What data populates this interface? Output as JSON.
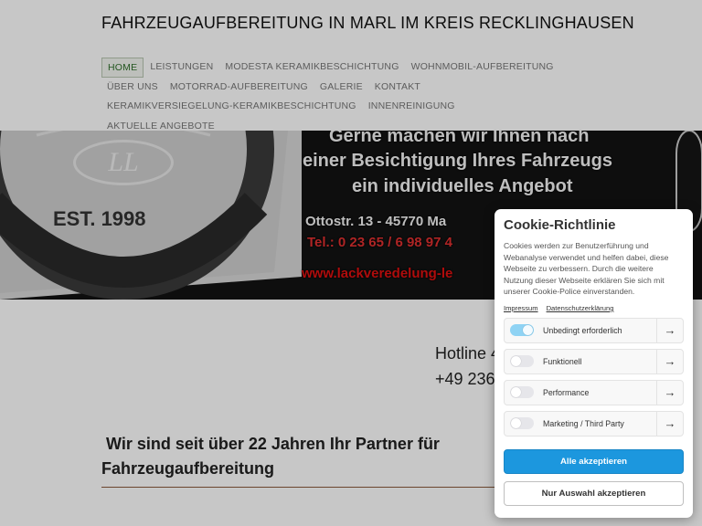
{
  "site": {
    "title": "FAHRZEUGAUFBEREITUNG IN MARL IM KREIS RECKLINGHAUSEN",
    "nav": [
      "HOME",
      "LEISTUNGEN",
      "MODESTA KERAMIKBESCHICHTUNG",
      "WOHNMOBIL-AUFBEREITUNG",
      "ÜBER UNS",
      "MOTORRAD-AUFBEREITUNG",
      "GALERIE",
      "KONTAKT",
      "KERAMIKVERSIEGELUNG-KERAMIKBESCHICHTUNG",
      "INNENREINIGUNG",
      "AKTUELLE ANGEBOTE"
    ],
    "active_nav": "HOME"
  },
  "banner": {
    "line1": "Gerne machen wir Ihnen nach",
    "line2": "einer Besichtigung Ihres Fahrzeugs",
    "line3": "ein individuelles Angebot",
    "address": "Ottostr. 13  - 45770 Ma",
    "phone": "Tel.: 0 23 65 / 6 98 97 4",
    "url": "www.lackveredelung-le",
    "est": "EST. 1998",
    "logo_ring_text": "CAR-DETAILING",
    "logo_monogram": "LL"
  },
  "content": {
    "hotline": "Hotline 4",
    "phone": "+49 236",
    "headline_line1": " Wir sind seit über 22 Jahren Ihr Partner für",
    "headline_line2": "Fahrzeugaufbereitung"
  },
  "cookie": {
    "title": "Cookie-Richtlinie",
    "text": "Cookies werden zur Benutzerführung und Webanalyse verwendet und helfen dabei, diese Webseite zu verbessern. Durch die weitere Nutzung dieser Webseite erklären Sie sich mit unserer Cookie-Police einverstanden.",
    "link_impressum": "Impressum",
    "link_privacy": "Datenschutzerklärung",
    "categories": [
      {
        "label": "Unbedingt erforderlich",
        "on": true
      },
      {
        "label": "Funktionell",
        "on": false
      },
      {
        "label": "Performance",
        "on": false
      },
      {
        "label": "Marketing / Third Party",
        "on": false
      }
    ],
    "accept_all": "Alle akzeptieren",
    "accept_selection": "Nur Auswahl akzeptieren"
  },
  "colors": {
    "accent": "#1c97de",
    "toggle_on": "#8fd3f4",
    "nav_active": "#2f6f2a"
  }
}
